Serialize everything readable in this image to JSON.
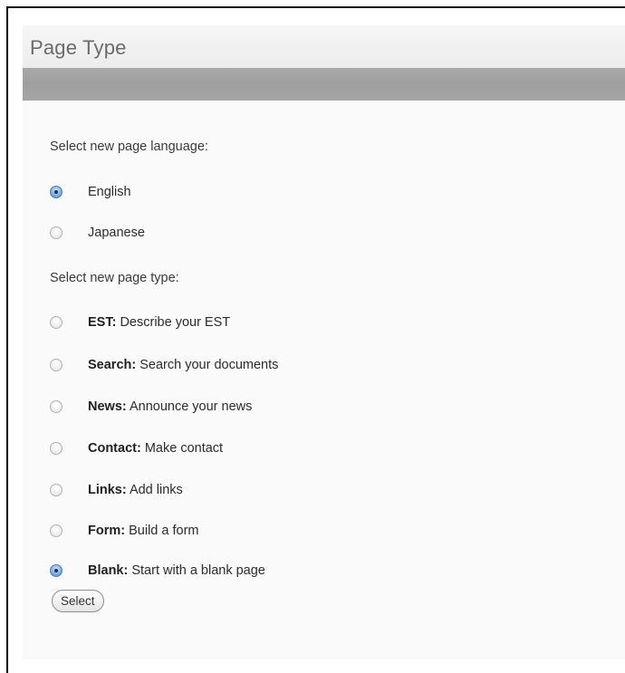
{
  "panel": {
    "title": "Page Type"
  },
  "language": {
    "prompt": "Select new page language:",
    "options": [
      {
        "label": "English",
        "checked": true
      },
      {
        "label": "Japanese",
        "checked": false
      }
    ]
  },
  "page_type": {
    "prompt": "Select new page type:",
    "options": [
      {
        "name": "EST:",
        "desc": "Describe your EST",
        "checked": false
      },
      {
        "name": "Search:",
        "desc": "Search your documents",
        "checked": false
      },
      {
        "name": "News:",
        "desc": "Announce your news",
        "checked": false
      },
      {
        "name": "Contact:",
        "desc": "Make contact",
        "checked": false
      },
      {
        "name": "Links:",
        "desc": "Add links",
        "checked": false
      },
      {
        "name": "Form:",
        "desc": "Build a form",
        "checked": false
      },
      {
        "name": "Blank:",
        "desc": "Start with a blank page",
        "checked": true
      }
    ]
  },
  "actions": {
    "select_label": "Select"
  },
  "colors": {
    "radio_selected": "#6fa1dd",
    "header_bar": "#a4a4a4"
  }
}
